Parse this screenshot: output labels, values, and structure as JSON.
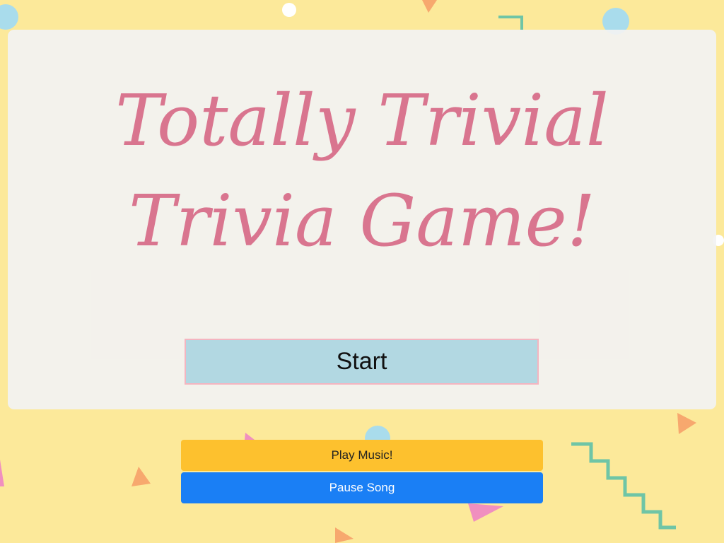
{
  "title": {
    "line1": "Totally Trivial",
    "line2": "Trivia Game!"
  },
  "start_button": {
    "label": "Start"
  },
  "music_controls": {
    "play_label": "Play Music!",
    "pause_label": "Pause Song"
  },
  "colors": {
    "background": "#fce99a",
    "panel": "#f2f2f2",
    "title": "#d9758f",
    "start_fill": "#b2d8e2",
    "start_border": "#f4b5c0",
    "play": "#fdc12e",
    "pause": "#1a7ff5"
  }
}
